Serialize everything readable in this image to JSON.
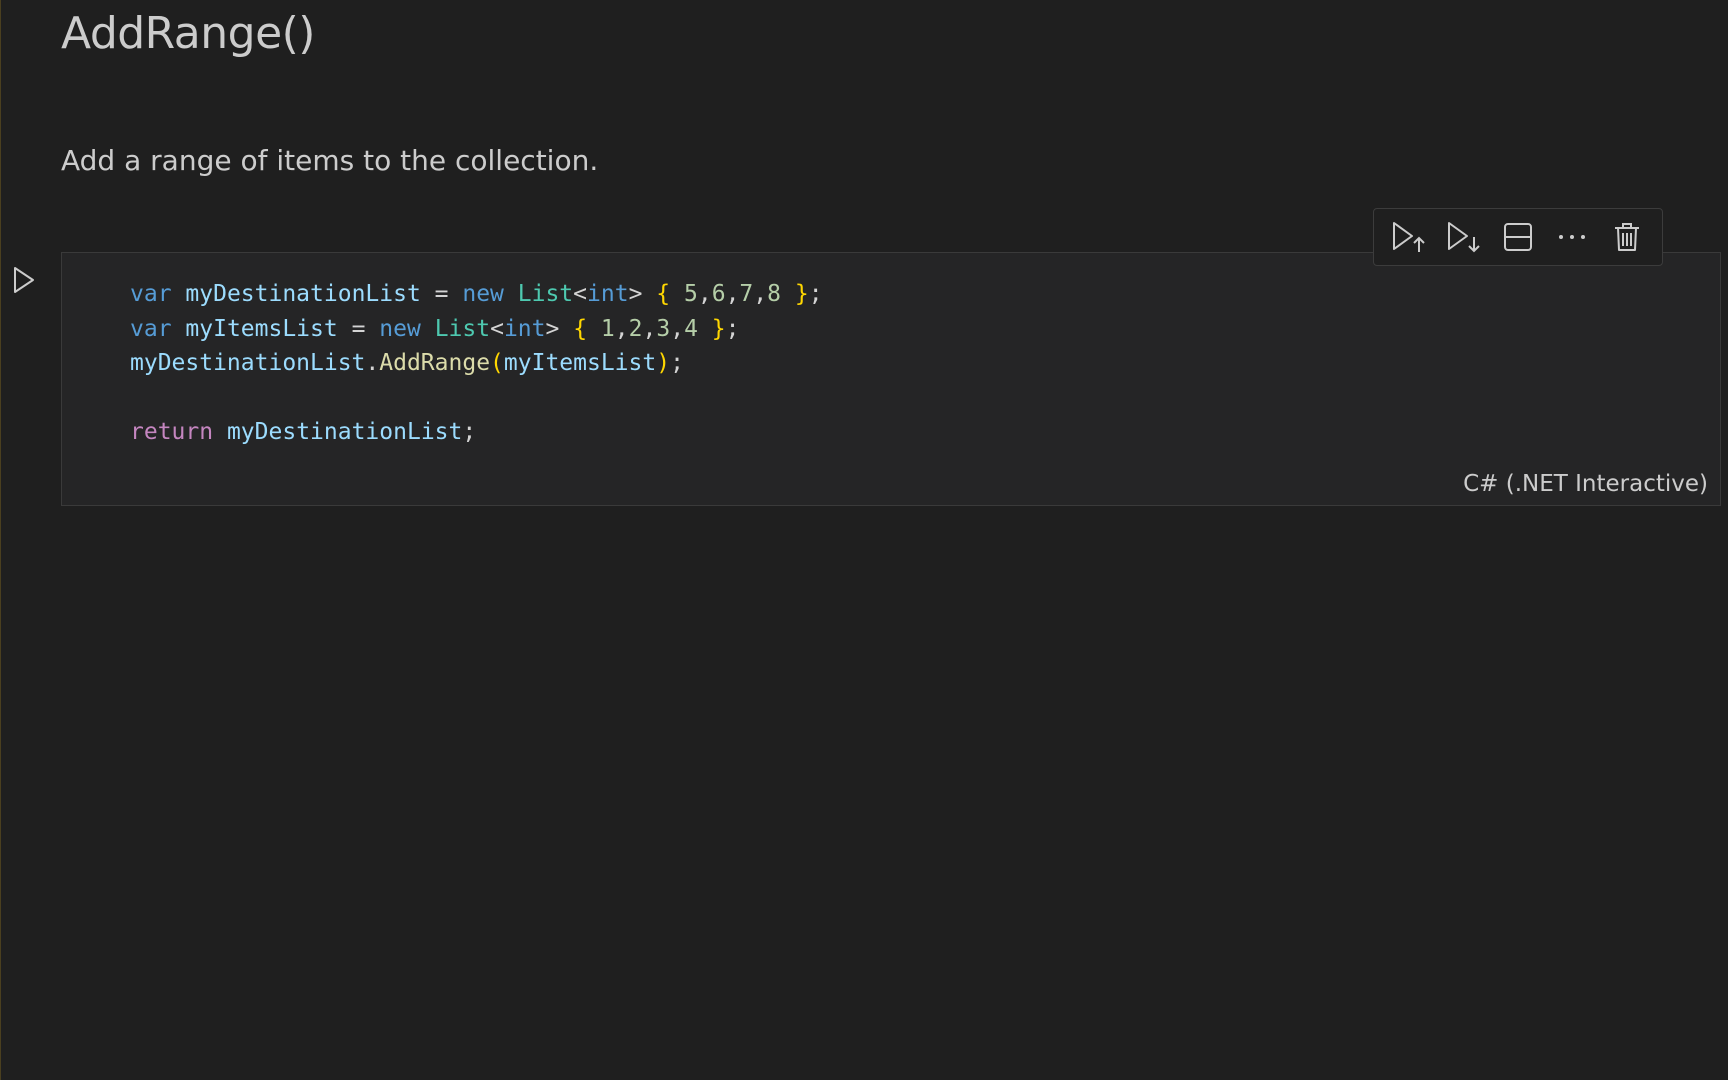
{
  "markdown": {
    "title": "AddRange()",
    "description": "Add a range of items to the collection."
  },
  "cell_toolbar": {
    "buttons": [
      {
        "name": "execute-above-icon"
      },
      {
        "name": "execute-below-icon"
      },
      {
        "name": "split-cell-icon"
      },
      {
        "name": "more-actions-icon"
      },
      {
        "name": "delete-cell-icon"
      }
    ]
  },
  "code_cell": {
    "language": "C# (.NET Interactive)",
    "lines": [
      [
        {
          "t": "kw",
          "v": "var"
        },
        {
          "t": "pu",
          "v": " "
        },
        {
          "t": "id",
          "v": "myDestinationList"
        },
        {
          "t": "pu",
          "v": " = "
        },
        {
          "t": "kw",
          "v": "new"
        },
        {
          "t": "pu",
          "v": " "
        },
        {
          "t": "ty",
          "v": "List"
        },
        {
          "t": "pu",
          "v": "<"
        },
        {
          "t": "kw",
          "v": "int"
        },
        {
          "t": "pu",
          "v": "> "
        },
        {
          "t": "br",
          "v": "{"
        },
        {
          "t": "pu",
          "v": " "
        },
        {
          "t": "num",
          "v": "5"
        },
        {
          "t": "pu",
          "v": ","
        },
        {
          "t": "num",
          "v": "6"
        },
        {
          "t": "pu",
          "v": ","
        },
        {
          "t": "num",
          "v": "7"
        },
        {
          "t": "pu",
          "v": ","
        },
        {
          "t": "num",
          "v": "8"
        },
        {
          "t": "pu",
          "v": " "
        },
        {
          "t": "br",
          "v": "}"
        },
        {
          "t": "pu",
          "v": ";"
        }
      ],
      [
        {
          "t": "kw",
          "v": "var"
        },
        {
          "t": "pu",
          "v": " "
        },
        {
          "t": "id",
          "v": "myItemsList"
        },
        {
          "t": "pu",
          "v": " = "
        },
        {
          "t": "kw",
          "v": "new"
        },
        {
          "t": "pu",
          "v": " "
        },
        {
          "t": "ty",
          "v": "List"
        },
        {
          "t": "pu",
          "v": "<"
        },
        {
          "t": "kw",
          "v": "int"
        },
        {
          "t": "pu",
          "v": "> "
        },
        {
          "t": "br",
          "v": "{"
        },
        {
          "t": "pu",
          "v": " "
        },
        {
          "t": "num",
          "v": "1"
        },
        {
          "t": "pu",
          "v": ","
        },
        {
          "t": "num",
          "v": "2"
        },
        {
          "t": "pu",
          "v": ","
        },
        {
          "t": "num",
          "v": "3"
        },
        {
          "t": "pu",
          "v": ","
        },
        {
          "t": "num",
          "v": "4"
        },
        {
          "t": "pu",
          "v": " "
        },
        {
          "t": "br",
          "v": "}"
        },
        {
          "t": "pu",
          "v": ";"
        }
      ],
      [
        {
          "t": "id",
          "v": "myDestinationList"
        },
        {
          "t": "pu",
          "v": "."
        },
        {
          "t": "fn",
          "v": "AddRange"
        },
        {
          "t": "br",
          "v": "("
        },
        {
          "t": "id",
          "v": "myItemsList"
        },
        {
          "t": "br",
          "v": ")"
        },
        {
          "t": "pu",
          "v": ";"
        }
      ],
      [],
      [
        {
          "t": "ctl",
          "v": "return"
        },
        {
          "t": "pu",
          "v": " "
        },
        {
          "t": "id",
          "v": "myDestinationList"
        },
        {
          "t": "pu",
          "v": ";"
        }
      ]
    ]
  },
  "colors": {
    "background": "#1f1f1f",
    "cell_background": "#252526",
    "keyword": "#569cd6",
    "control_keyword": "#c586c0",
    "identifier": "#9cdcfe",
    "type": "#4ec9b0",
    "bracket": "#ffd700",
    "number": "#b5cea8",
    "function": "#dcdcaa"
  }
}
